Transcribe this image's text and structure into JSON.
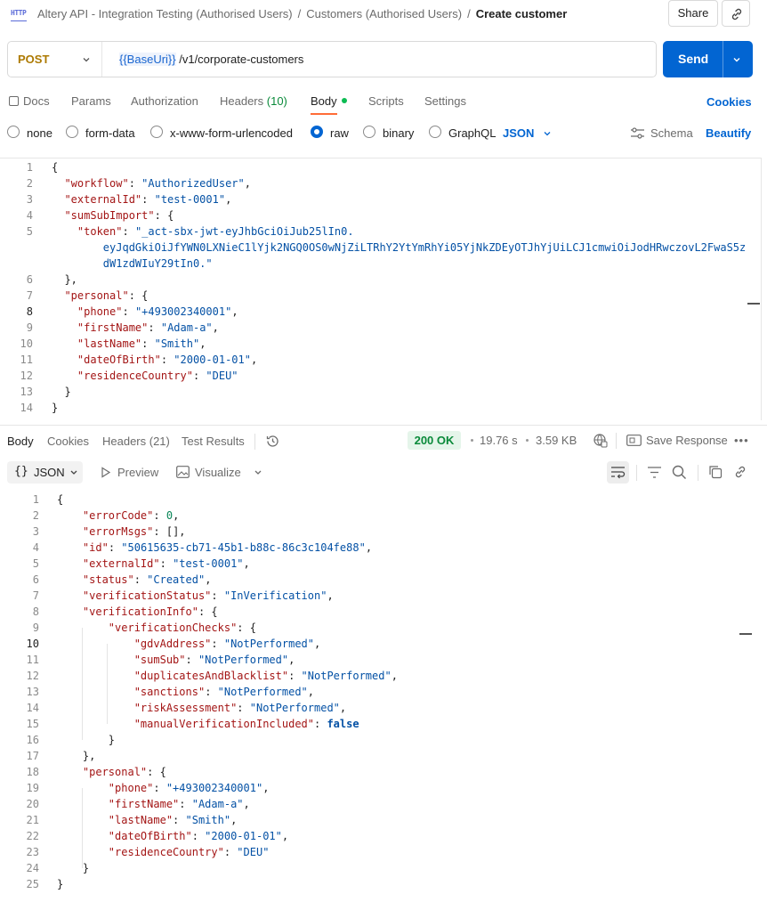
{
  "breadcrumb": {
    "icon": "http-icon",
    "icon_text": "HTTP",
    "items": [
      "Altery API - Integration Testing (Authorised Users)",
      "Customers (Authorised Users)"
    ],
    "separator": "/",
    "current": "Create customer"
  },
  "header": {
    "share_label": "Share",
    "link_icon": "link-icon"
  },
  "request": {
    "method": "POST",
    "url_var": "{{BaseUri}}",
    "url_path": " /v1/corporate-customers",
    "send_label": "Send"
  },
  "request_tabs": {
    "docs": "Docs",
    "params": "Params",
    "authorization": "Authorization",
    "headers": "Headers",
    "headers_count": "(10)",
    "body": "Body",
    "scripts": "Scripts",
    "settings": "Settings",
    "cookies": "Cookies"
  },
  "body_modes": {
    "none": "none",
    "form_data": "form-data",
    "urlencoded": "x-www-form-urlencoded",
    "raw": "raw",
    "binary": "binary",
    "graphql": "GraphQL",
    "format": "JSON",
    "schema": "Schema",
    "beautify": "Beautify",
    "selected": "raw"
  },
  "request_body_lines": [
    {
      "n": "1",
      "indent": 0,
      "text": "{"
    },
    {
      "n": "2",
      "indent": 1,
      "key": "workflow",
      "value": "AuthorizedUser",
      "tail": ","
    },
    {
      "n": "3",
      "indent": 1,
      "key": "externalId",
      "value": "test-0001",
      "tail": ","
    },
    {
      "n": "4",
      "indent": 1,
      "key": "sumSubImport",
      "raw": "{"
    },
    {
      "n": "5",
      "indent": 2,
      "key": "token",
      "value_start": "_act-sbx-jwt-eyJhbGciOiJub25lIn0."
    },
    {
      "n": "",
      "indent": 4,
      "cont": "eyJqdGkiOiJfYWN0LXNieC1lYjk2NGQ0OS0wNjZiLTRhY2YtYmRhYi05YjNkZDEyOTJhYjUiLCJ1cmwiOiJodHRwczovL2FwaS5z"
    },
    {
      "n": "",
      "indent": 4,
      "cont_end": "dW1zdWIuY29tIn0.",
      "tail": ""
    },
    {
      "n": "6",
      "indent": 1,
      "text": "},"
    },
    {
      "n": "7",
      "indent": 1,
      "key": "personal",
      "raw": "{"
    },
    {
      "n": "8",
      "indent": 2,
      "key": "phone",
      "value": "+493002340001",
      "tail": ","
    },
    {
      "n": "9",
      "indent": 2,
      "key": "firstName",
      "value": "Adam-a",
      "tail": ","
    },
    {
      "n": "10",
      "indent": 2,
      "key": "lastName",
      "value": "Smith",
      "tail": ","
    },
    {
      "n": "11",
      "indent": 2,
      "key": "dateOfBirth",
      "value": "2000-01-01",
      "tail": ","
    },
    {
      "n": "12",
      "indent": 2,
      "key": "residenceCountry",
      "value": "DEU",
      "tail": ""
    },
    {
      "n": "13",
      "indent": 1,
      "text": "}"
    },
    {
      "n": "14",
      "indent": 0,
      "text": "}"
    }
  ],
  "response": {
    "tabs": {
      "body": "Body",
      "cookies": "Cookies",
      "headers": "Headers (21)",
      "test_results": "Test Results"
    },
    "status": "200 OK",
    "time": "19.76 s",
    "size": "3.59 KB",
    "save_response": "Save Response",
    "format": "JSON",
    "preview": "Preview",
    "visualize": "Visualize"
  },
  "response_body_lines": [
    {
      "n": "1",
      "indent": 0,
      "text": "{"
    },
    {
      "n": "2",
      "indent": 1,
      "key": "errorCode",
      "num": "0",
      "tail": ","
    },
    {
      "n": "3",
      "indent": 1,
      "key": "errorMsgs",
      "raw": "[],"
    },
    {
      "n": "4",
      "indent": 1,
      "key": "id",
      "value": "50615635-cb71-45b1-b88c-86c3c104fe88",
      "tail": ","
    },
    {
      "n": "5",
      "indent": 1,
      "key": "externalId",
      "value": "test-0001",
      "tail": ","
    },
    {
      "n": "6",
      "indent": 1,
      "key": "status",
      "value": "Created",
      "tail": ","
    },
    {
      "n": "7",
      "indent": 1,
      "key": "verificationStatus",
      "value": "InVerification",
      "tail": ","
    },
    {
      "n": "8",
      "indent": 1,
      "key": "verificationInfo",
      "raw": "{"
    },
    {
      "n": "9",
      "indent": 2,
      "key": "verificationChecks",
      "raw": "{"
    },
    {
      "n": "10",
      "indent": 3,
      "key": "gdvAddress",
      "value": "NotPerformed",
      "tail": ","
    },
    {
      "n": "11",
      "indent": 3,
      "key": "sumSub",
      "value": "NotPerformed",
      "tail": ","
    },
    {
      "n": "12",
      "indent": 3,
      "key": "duplicatesAndBlacklist",
      "value": "NotPerformed",
      "tail": ","
    },
    {
      "n": "13",
      "indent": 3,
      "key": "sanctions",
      "value": "NotPerformed",
      "tail": ","
    },
    {
      "n": "14",
      "indent": 3,
      "key": "riskAssessment",
      "value": "NotPerformed",
      "tail": ","
    },
    {
      "n": "15",
      "indent": 3,
      "key": "manualVerificationIncluded",
      "bool": "false",
      "tail": ""
    },
    {
      "n": "16",
      "indent": 2,
      "text": "}"
    },
    {
      "n": "17",
      "indent": 1,
      "text": "},"
    },
    {
      "n": "18",
      "indent": 1,
      "key": "personal",
      "raw": "{"
    },
    {
      "n": "19",
      "indent": 2,
      "key": "phone",
      "value": "+493002340001",
      "tail": ","
    },
    {
      "n": "20",
      "indent": 2,
      "key": "firstName",
      "value": "Adam-a",
      "tail": ","
    },
    {
      "n": "21",
      "indent": 2,
      "key": "lastName",
      "value": "Smith",
      "tail": ","
    },
    {
      "n": "22",
      "indent": 2,
      "key": "dateOfBirth",
      "value": "2000-01-01",
      "tail": ","
    },
    {
      "n": "23",
      "indent": 2,
      "key": "residenceCountry",
      "value": "DEU",
      "tail": ""
    },
    {
      "n": "24",
      "indent": 1,
      "text": "}"
    },
    {
      "n": "25",
      "indent": 0,
      "text": "}"
    }
  ]
}
